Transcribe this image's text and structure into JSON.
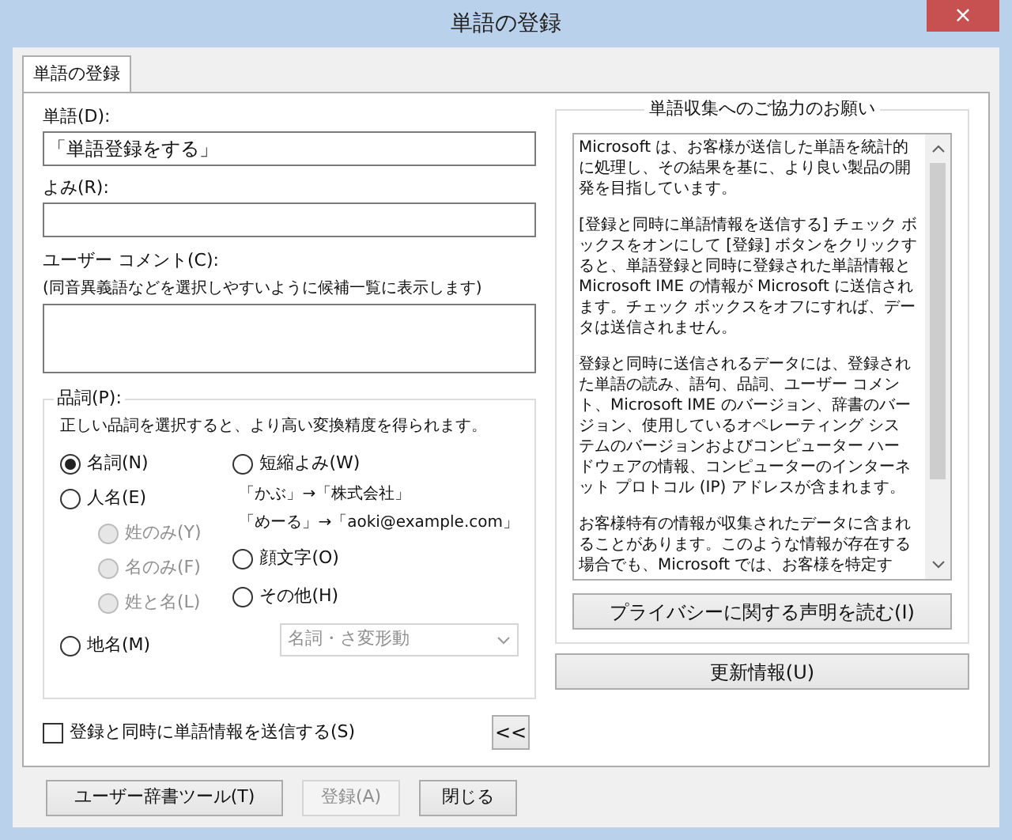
{
  "window": {
    "title": "単語の登録",
    "close": "×"
  },
  "tabs": [
    {
      "label": "単語の登録",
      "selected": true
    }
  ],
  "word": {
    "label": "単語(D):",
    "value": "「単語登録をする」"
  },
  "reading": {
    "label": "よみ(R):"
  },
  "comment": {
    "label": "ユーザー コメント(C):",
    "hint": "(同音異義語などを選択しやすいように候補一覧に表示します)"
  },
  "part_of_speech": {
    "label": "品詞(P):",
    "hint": "正しい品詞を選択すると、より高い変換精度を得られます。",
    "left": [
      {
        "label": "名詞(N)",
        "selected": true,
        "disabled": false
      },
      {
        "label": "人名(E)",
        "selected": false,
        "disabled": false,
        "children": [
          {
            "label": "姓のみ(Y)",
            "selected": false,
            "disabled": true
          },
          {
            "label": "名のみ(F)",
            "selected": false,
            "disabled": true
          },
          {
            "label": "姓と名(L)",
            "selected": false,
            "disabled": true
          }
        ]
      },
      {
        "label": "地名(M)",
        "selected": false,
        "disabled": false
      }
    ],
    "right": [
      {
        "kind": "radio",
        "label": "短縮よみ(W)",
        "selected": false,
        "disabled": false
      },
      {
        "kind": "note",
        "label": "「かぶ」→「株式会社」"
      },
      {
        "kind": "note",
        "label": "「めーる」→「aoki@example.com」"
      },
      {
        "kind": "radio",
        "label": "顔文字(O)",
        "selected": false,
        "disabled": false
      },
      {
        "kind": "radio",
        "label": "その他(H)",
        "selected": false,
        "disabled": false
      }
    ],
    "dropdown": {
      "value": "名詞・さ変形動",
      "disabled": true
    }
  },
  "send_checkbox": {
    "label": "登録と同時に単語情報を送信する(S)",
    "checked": false
  },
  "collapse_button": "<<",
  "info_panel": {
    "title": "単語収集へのご協力のお願い",
    "paragraphs": [
      "Microsoft は、お客様が送信した単語を統計的に処理し、その結果を基に、より良い製品の開発を目指しています。",
      "[登録と同時に単語情報を送信する] チェック ボックスをオンにして [登録] ボタンをクリックすると、単語登録と同時に登録された単語情報と Microsoft IME の情報が Microsoft に送信されます。チェック ボックスをオフにすれば、データは送信されません。",
      "登録と同時に送信されるデータには、登録された単語の読み、語句、品詞、ユーザー コメント、Microsoft IME のバージョン、辞書のバージョン、使用しているオペレーティング システムのバージョンおよびコンピューター ハードウェアの情報、コンピューターのインターネット プロトコル (IP) アドレスが含まれます。",
      "お客様特有の情報が収集されたデータに含まれることがあります。このような情報が存在する場合でも、Microsoft では、お客様を特定す"
    ],
    "privacy_button": "プライバシーに関する声明を読む(I)"
  },
  "update_button": "更新情報(U)",
  "buttons": [
    {
      "label": "ユーザー辞書ツール(T)",
      "disabled": false
    },
    {
      "label": "登録(A)",
      "disabled": true
    },
    {
      "label": "閉じる",
      "disabled": false
    }
  ]
}
